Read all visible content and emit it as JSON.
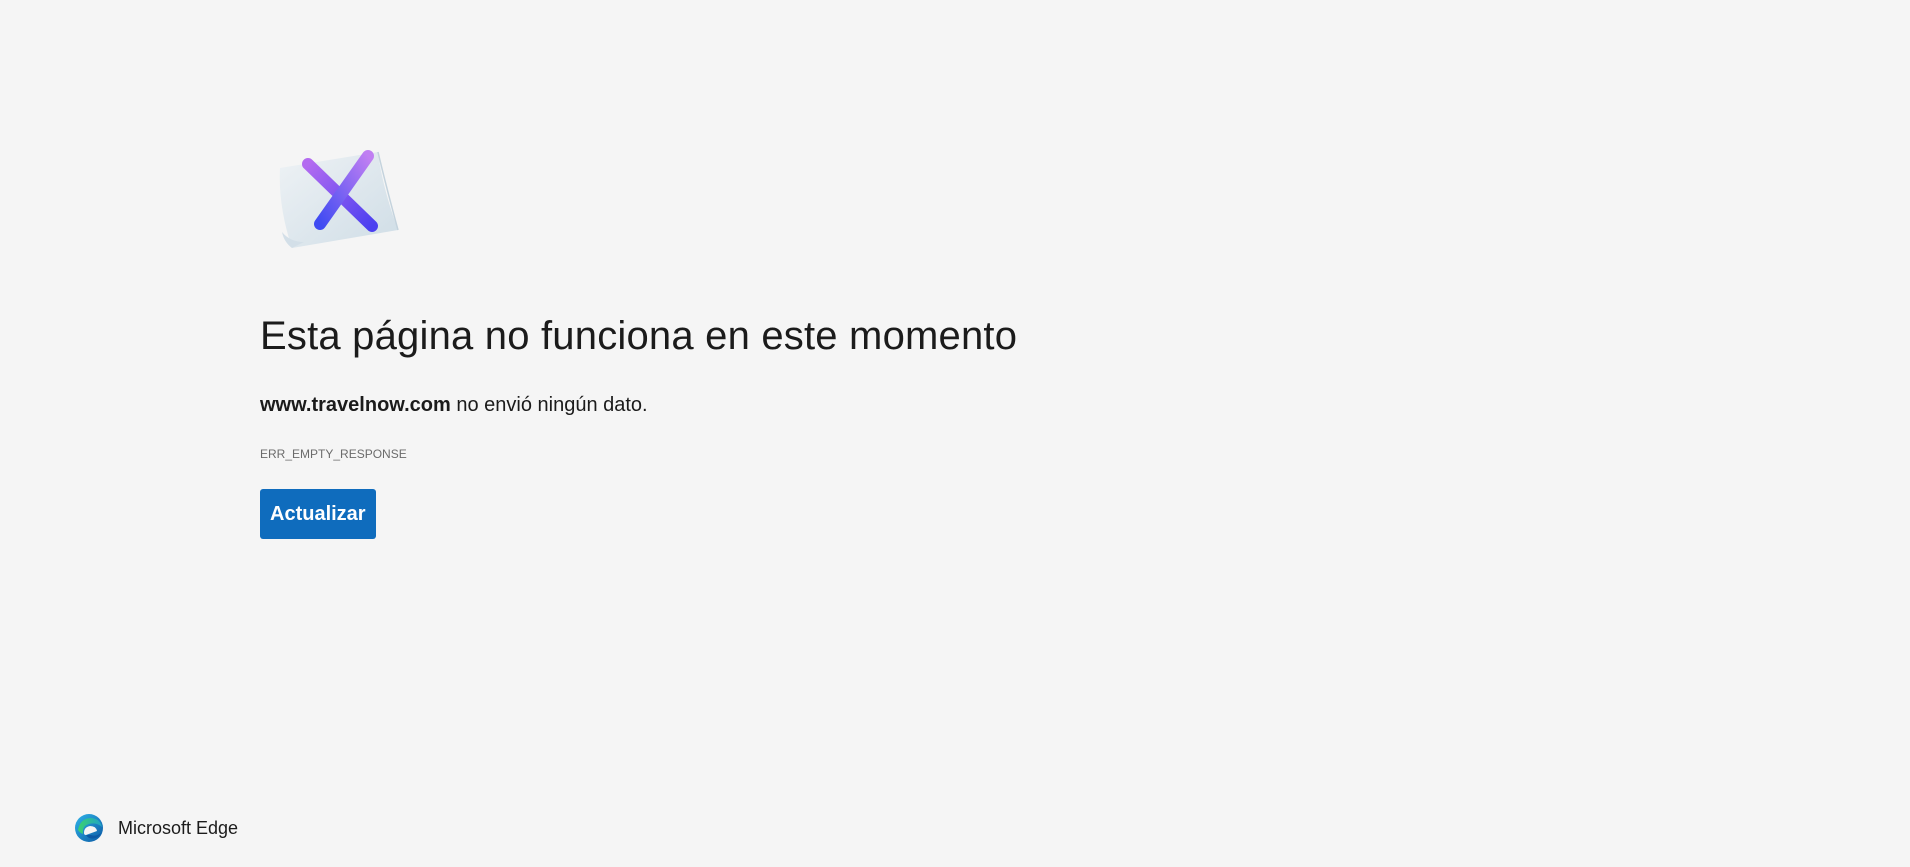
{
  "error_page": {
    "illustration_icon": "paper-x-icon",
    "title": "Esta página no funciona en este momento",
    "host": "www.travelnow.com",
    "message": "no envió ningún dato.",
    "error_code": "ERR_EMPTY_RESPONSE",
    "refresh_label": "Actualizar"
  },
  "footer": {
    "brand_icon": "microsoft-edge-logo-icon",
    "brand_name": "Microsoft Edge"
  },
  "colors": {
    "background": "#f5f5f5",
    "button_bg": "#0f6cbd",
    "button_text": "#ffffff",
    "text": "#1b1b1b",
    "muted_text": "#6b6b6b"
  }
}
